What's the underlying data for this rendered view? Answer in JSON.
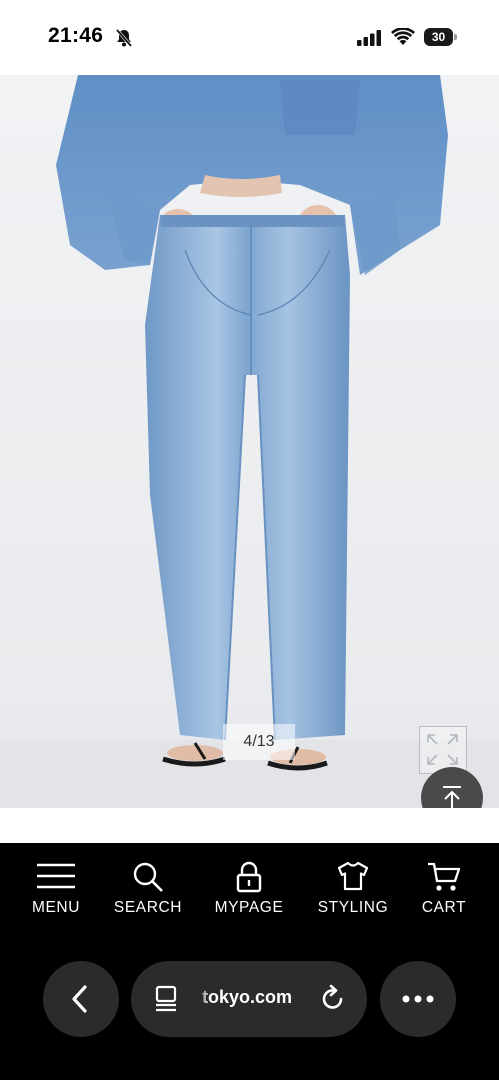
{
  "status_bar": {
    "time": "21:46",
    "battery_level": "30",
    "icons": [
      "bell-off-icon",
      "cellular-signal-icon",
      "wifi-icon",
      "battery-icon"
    ]
  },
  "product": {
    "image_subject": "wide leg light-wash denim jeans worn with denim shirt and black sandals",
    "image_counter": "4/13",
    "expand_icon": "expand-icon",
    "scroll_top_icon": "arrow-up-to-top-icon"
  },
  "bottom_nav": {
    "items": [
      {
        "label": "MENU",
        "icon": "hamburger-menu-icon"
      },
      {
        "label": "SEARCH",
        "icon": "search-icon"
      },
      {
        "label": "MYPAGE",
        "icon": "lock-icon"
      },
      {
        "label": "STYLING",
        "icon": "t-shirt-icon"
      },
      {
        "label": "CART",
        "icon": "cart-icon"
      }
    ]
  },
  "browser": {
    "url": "tokyo.com",
    "icons": [
      "chevron-left-icon",
      "page-menu-icon",
      "reload-icon",
      "more-dots-icon"
    ]
  },
  "colors": {
    "nav_background": "#000000",
    "pill_background": "#2b2b2b",
    "denim": "#7ea5d2"
  }
}
